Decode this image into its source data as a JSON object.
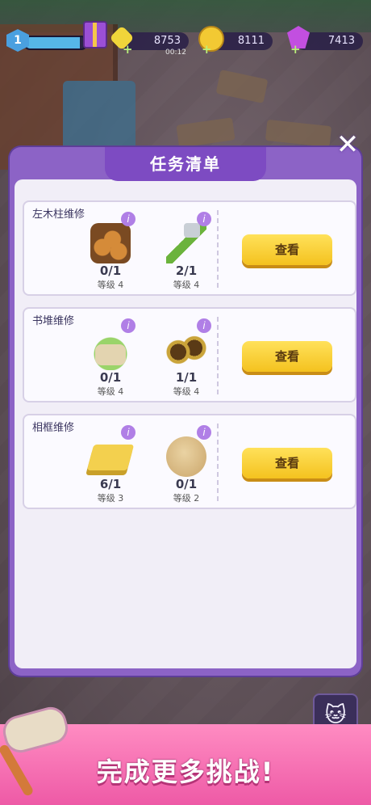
{
  "hud": {
    "level": "1",
    "xp_progress": 0.9,
    "timer": "00:12",
    "resources": [
      {
        "name": "gem-yellow",
        "value": "8753"
      },
      {
        "name": "paw-coin",
        "value": "8111"
      },
      {
        "name": "gem-purple",
        "value": "7413"
      }
    ],
    "plus_symbol": "+"
  },
  "modal": {
    "title": "任务清单",
    "close_symbol": "✕",
    "tasks": [
      {
        "name": "左木柱维修",
        "button": "查看",
        "items": [
          {
            "icon": "logs-icon",
            "count": "0/1",
            "level": "等级 4"
          },
          {
            "icon": "axe-icon",
            "count": "2/1",
            "level": "等级 4"
          }
        ]
      },
      {
        "name": "书堆维修",
        "button": "查看",
        "items": [
          {
            "icon": "gloves-icon",
            "count": "0/1",
            "level": "等级 4"
          },
          {
            "icon": "glasses-icon",
            "count": "1/1",
            "level": "等级 4"
          }
        ]
      },
      {
        "name": "相框维修",
        "button": "查看",
        "items": [
          {
            "icon": "sponge-icon",
            "count": "6/1",
            "level": "等级 3"
          },
          {
            "icon": "pebble-icon",
            "count": "0/1",
            "level": "等级 2"
          }
        ]
      }
    ],
    "info_symbol": "i"
  },
  "banner": {
    "text": "完成更多挑战!"
  },
  "colors": {
    "accent_purple": "#8c63c6",
    "button_yellow": "#f4c21f",
    "banner_pink": "#ee5aa6"
  }
}
